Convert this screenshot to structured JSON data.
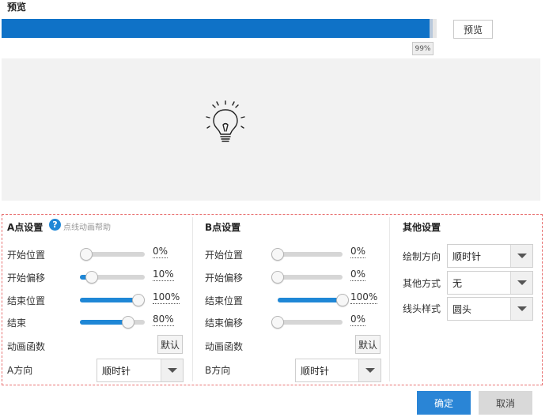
{
  "header": {
    "title": "预览"
  },
  "progress": {
    "value": 99,
    "label": "99%"
  },
  "toolbar": {
    "preview_button": "预览"
  },
  "section_a": {
    "title": "A点设置",
    "help_text": "点线动画帮助",
    "rows": [
      {
        "label": "开始位置",
        "value": 0,
        "display": "0%"
      },
      {
        "label": "开始偏移",
        "value": 10,
        "display": "10%"
      },
      {
        "label": "结束位置",
        "value": 100,
        "display": "100%"
      },
      {
        "label": "结束",
        "value": 80,
        "display": "80%"
      }
    ],
    "anim_label": "动画函数",
    "default_button": "默认",
    "direction_label": "A方向",
    "direction_value": "顺时针"
  },
  "section_b": {
    "title": "B点设置",
    "rows": [
      {
        "label": "开始位置",
        "value": 0,
        "display": "0%"
      },
      {
        "label": "开始偏移",
        "value": 0,
        "display": "0%"
      },
      {
        "label": "结束位置",
        "value": 100,
        "display": "100%"
      },
      {
        "label": "结束偏移",
        "value": 0,
        "display": "0%"
      }
    ],
    "anim_label": "动画函数",
    "default_button": "默认",
    "direction_label": "B方向",
    "direction_value": "顺时针"
  },
  "section_other": {
    "title": "其他设置",
    "rows": [
      {
        "label": "绘制方向",
        "value": "顺时针"
      },
      {
        "label": "其他方式",
        "value": "无"
      },
      {
        "label": "线头样式",
        "value": "圆头"
      }
    ]
  },
  "footer": {
    "ok_button": "确定",
    "cancel_button": "取消"
  },
  "colors": {
    "accent": "#1f87d6",
    "progress": "#0f72c7",
    "panel_border": "#e87171"
  }
}
